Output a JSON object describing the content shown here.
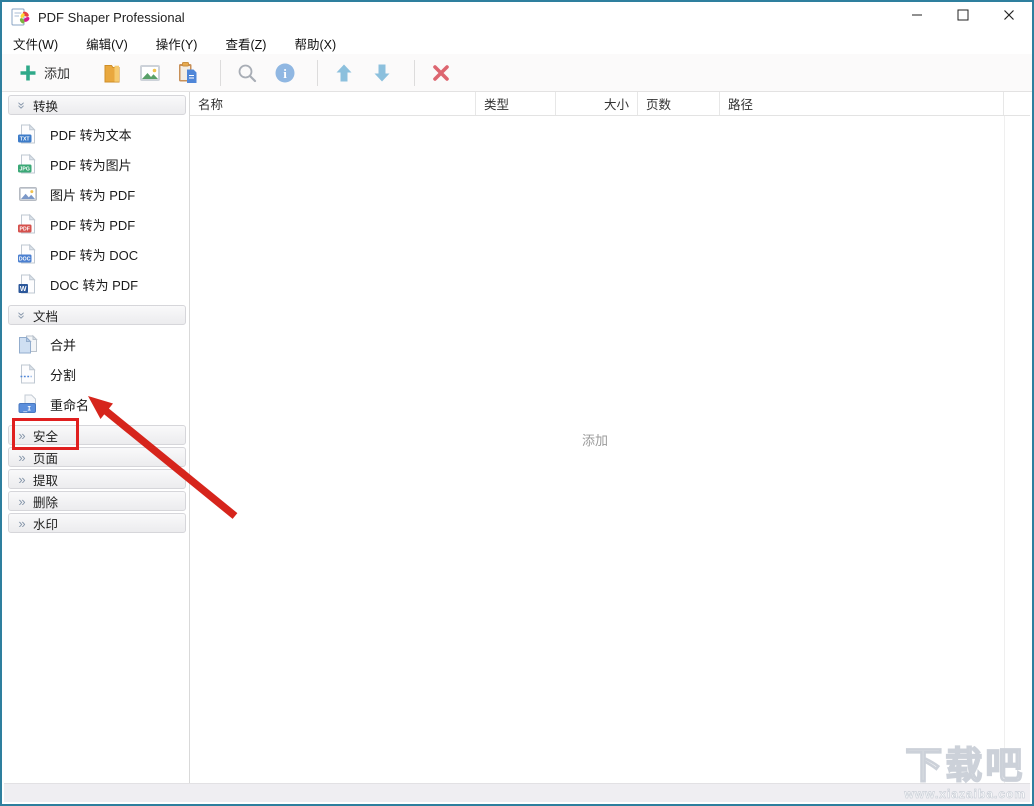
{
  "window": {
    "title": "PDF Shaper Professional",
    "controls": [
      {
        "name": "minimize",
        "icon": "minimize-icon"
      },
      {
        "name": "maximize",
        "icon": "maximize-icon"
      },
      {
        "name": "close",
        "icon": "close-icon"
      }
    ]
  },
  "menu": {
    "items": [
      {
        "name": "file",
        "label": "文件(W)"
      },
      {
        "name": "edit",
        "label": "编辑(V)"
      },
      {
        "name": "actions",
        "label": "操作(Y)"
      },
      {
        "name": "view",
        "label": "查看(Z)"
      },
      {
        "name": "help",
        "label": "帮助(X)"
      }
    ]
  },
  "toolbar": {
    "buttons": [
      {
        "name": "add",
        "icon": "plus-icon",
        "label": "添加"
      },
      {
        "name": "add-folder",
        "icon": "folder-icon"
      },
      {
        "name": "add-images",
        "icon": "image-icon"
      },
      {
        "name": "paste",
        "icon": "paste-icon"
      },
      {
        "type": "separator"
      },
      {
        "name": "search",
        "icon": "search-icon"
      },
      {
        "name": "info",
        "icon": "info-icon"
      },
      {
        "type": "separator"
      },
      {
        "name": "move-up",
        "icon": "arrow-up-icon"
      },
      {
        "name": "move-down",
        "icon": "arrow-down-icon"
      },
      {
        "type": "separator"
      },
      {
        "name": "remove",
        "icon": "delete-x-icon"
      }
    ]
  },
  "sidebar": {
    "sections": [
      {
        "name": "convert",
        "label": "转换",
        "state": "expanded",
        "items": [
          {
            "name": "pdf-to-text",
            "label": "PDF 转为文本",
            "icon": "txt-file-icon"
          },
          {
            "name": "pdf-to-image",
            "label": "PDF 转为图片",
            "icon": "jpg-file-icon"
          },
          {
            "name": "image-to-pdf",
            "label": "图片 转为 PDF",
            "icon": "image-file-icon"
          },
          {
            "name": "pdf-to-pdf",
            "label": "PDF 转为 PDF",
            "icon": "pdf-file-icon"
          },
          {
            "name": "pdf-to-doc",
            "label": "PDF 转为 DOC",
            "icon": "doc-file-icon"
          },
          {
            "name": "doc-to-pdf",
            "label": "DOC 转为 PDF",
            "icon": "word-file-icon"
          }
        ]
      },
      {
        "name": "document",
        "label": "文档",
        "state": "expanded",
        "items": [
          {
            "name": "merge",
            "label": "合并",
            "icon": "merge-icon",
            "highlighted": true
          },
          {
            "name": "split",
            "label": "分割",
            "icon": "split-icon"
          },
          {
            "name": "rename",
            "label": "重命名",
            "icon": "rename-icon"
          }
        ]
      },
      {
        "name": "security",
        "label": "安全",
        "state": "collapsed",
        "items": []
      },
      {
        "name": "pages",
        "label": "页面",
        "state": "collapsed",
        "items": []
      },
      {
        "name": "extract",
        "label": "提取",
        "state": "collapsed",
        "items": []
      },
      {
        "name": "delete",
        "label": "删除",
        "state": "collapsed",
        "items": []
      },
      {
        "name": "watermark",
        "label": "水印",
        "state": "collapsed",
        "items": []
      }
    ]
  },
  "table": {
    "columns": [
      {
        "name": "name",
        "label": "名称"
      },
      {
        "name": "type",
        "label": "类型"
      },
      {
        "name": "size",
        "label": "大小"
      },
      {
        "name": "pages",
        "label": "页数"
      },
      {
        "name": "path",
        "label": "路径"
      }
    ]
  },
  "main": {
    "empty_hint": "添加"
  },
  "watermark": {
    "title": "下载吧",
    "subtitle": "www.xiazaiba.com"
  },
  "colors": {
    "window_border": "#2e7f9e",
    "accent_green": "#2fa989",
    "arrow_red": "#d6251c",
    "highlight_red": "#e01f1f",
    "toolbar_icon_blue": "#8cc0dd"
  }
}
